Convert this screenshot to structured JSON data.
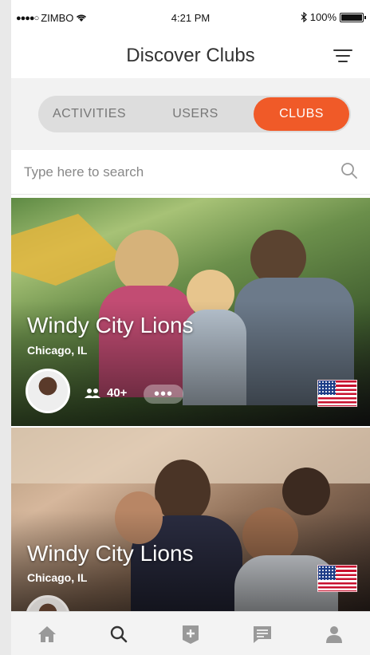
{
  "status_bar": {
    "carrier": "ZIMBO",
    "time": "4:21 PM",
    "battery": "100%"
  },
  "header": {
    "title": "Discover Clubs"
  },
  "segments": {
    "tabs": [
      {
        "label": "ACTIVITIES"
      },
      {
        "label": "USERS"
      },
      {
        "label": "CLUBS"
      }
    ],
    "active": "CLUBS",
    "accent_color": "#f05a28"
  },
  "search": {
    "placeholder": "Type here to search"
  },
  "clubs": [
    {
      "name": "Windy City Lions",
      "location": "Chicago, IL",
      "members": "40+",
      "more": "•••",
      "flag": "us-flag-icon"
    },
    {
      "name": "Windy City Lions",
      "location": "Chicago, IL",
      "flag": "us-flag-icon"
    }
  ],
  "tabbar": {
    "items": [
      "home-icon",
      "search-icon",
      "add-club-icon",
      "messages-icon",
      "profile-icon"
    ],
    "active": "search-icon"
  }
}
